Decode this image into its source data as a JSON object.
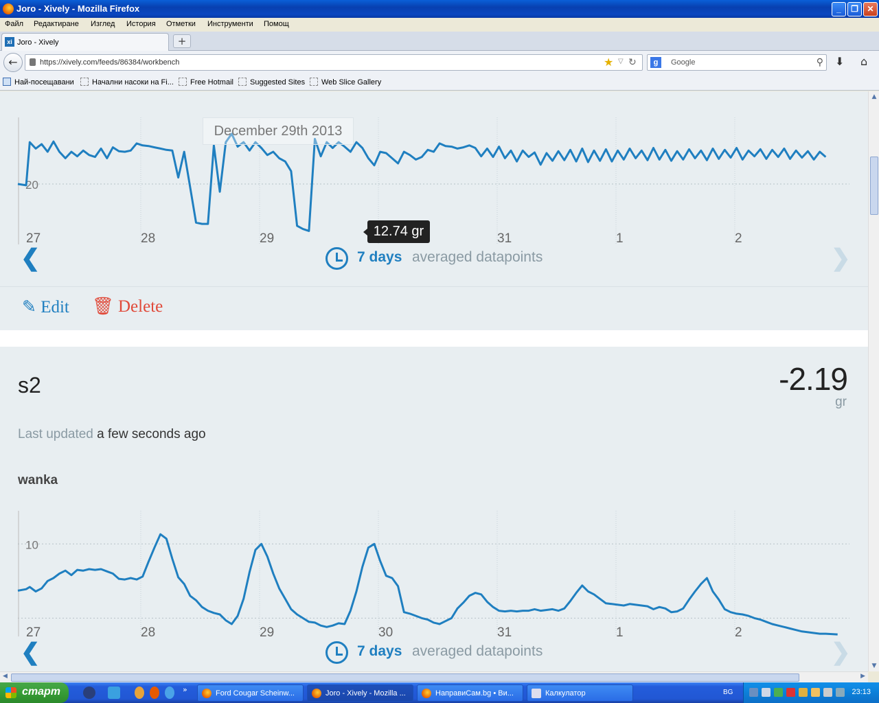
{
  "window": {
    "title": "Joro - Xively - Mozilla Firefox"
  },
  "menu": [
    "Файл",
    "Редактиране",
    "Изглед",
    "История",
    "Отметки",
    "Инструменти",
    "Помощ"
  ],
  "tab": {
    "label": "Joro - Xively"
  },
  "nav": {
    "url": "https://xively.com/feeds/86384/workbench",
    "search_placeholder": "Google"
  },
  "bookmarks": [
    "Най-посещавани",
    "Начални насоки на Fi...",
    "Free Hotmail",
    "Suggested Sites",
    "Web Slice Gallery"
  ],
  "chart1": {
    "tooltip_date": "December 29th 2013",
    "tooltip_value": "12.74 gr",
    "range_days": "7 days",
    "range_label": "averaged datapoints"
  },
  "actions": {
    "edit": "Edit",
    "delete": "Delete"
  },
  "datastream": {
    "id": "s2",
    "value": "-2.19",
    "unit": "gr",
    "updated_label": "Last updated",
    "updated_value": "a few seconds ago",
    "tag": "wanka"
  },
  "chart2": {
    "range_days": "7 days",
    "range_label": "averaged datapoints"
  },
  "chart_data": [
    {
      "type": "line",
      "title": "",
      "xlabel": "",
      "ylabel": "",
      "x_ticks": [
        "27",
        "28",
        "29",
        "30",
        "31",
        "1",
        "2"
      ],
      "y_ticks": [
        "20"
      ],
      "ylim": [
        12,
        28
      ],
      "grid": true,
      "x": [
        0,
        0.07,
        0.1,
        0.15,
        0.2,
        0.25,
        0.3,
        0.35,
        0.4,
        0.45,
        0.5,
        0.55,
        0.6,
        0.65,
        0.7,
        0.75,
        0.8,
        0.85,
        0.9,
        0.95,
        1.0,
        1.05,
        1.1,
        1.15,
        1.2,
        1.25,
        1.3,
        1.35,
        1.4,
        1.45,
        1.5,
        1.55,
        1.6,
        1.65,
        1.7,
        1.75,
        1.8,
        1.85,
        1.9,
        1.95,
        2.0,
        2.05,
        2.1,
        2.15,
        2.2,
        2.25,
        2.3,
        2.35,
        2.4,
        2.45,
        2.5,
        2.55,
        2.6,
        2.65,
        2.7,
        2.75,
        2.8,
        2.85,
        2.9,
        2.95,
        3.0,
        3.05,
        3.1,
        3.15,
        3.2,
        3.25,
        3.3,
        3.35,
        3.4,
        3.45,
        3.5,
        3.55,
        3.6,
        3.65,
        3.7,
        3.75,
        3.8,
        3.85,
        3.9,
        3.95,
        4.0,
        4.05,
        4.1,
        4.15,
        4.2,
        4.25,
        4.3,
        4.35,
        4.4,
        4.45,
        4.5,
        4.55,
        4.6,
        4.65,
        4.7,
        4.75,
        4.8,
        4.85,
        4.9,
        4.95,
        5.0,
        5.05,
        5.1,
        5.15,
        5.2,
        5.25,
        5.3,
        5.35,
        5.4,
        5.45,
        5.5,
        5.55,
        5.6,
        5.65,
        5.7,
        5.75,
        5.8,
        5.85,
        5.9,
        5.95,
        6.0,
        6.05,
        6.1,
        6.15,
        6.2,
        6.25,
        6.3,
        6.35,
        6.4,
        6.45,
        6.5,
        6.55,
        6.6,
        6.65,
        6.7,
        6.75,
        6.8,
        6.85,
        6.9,
        6.95,
        7.0
      ],
      "series": [
        {
          "values": [
            20,
            19.8,
            26.5,
            25.5,
            26.2,
            25.0,
            26.6,
            25.0,
            24.0,
            25.0,
            24.3,
            25.2,
            24.5,
            24.2,
            25.5,
            24.0,
            25.7,
            25.1,
            25.0,
            25.2,
            26.3,
            26.0,
            25.9,
            25.7,
            25.5,
            25.3,
            25.2,
            21.0,
            25.0,
            19.5,
            14.0,
            13.8,
            13.8,
            26.0,
            18.8,
            26.5,
            27.8,
            25.8,
            26.5,
            25.2,
            26.5,
            25.6,
            24.5,
            25.0,
            24.0,
            23.5,
            22.0,
            13.5,
            13.0,
            12.7,
            27.0,
            24.3,
            26.5,
            25.6,
            26.5,
            25.8,
            25.0,
            26.5,
            25.6,
            24.0,
            22.9,
            25.0,
            24.8,
            24.0,
            23.2,
            25.0,
            24.5,
            23.8,
            24.2,
            25.3,
            25.0,
            26.3,
            25.9,
            25.8,
            25.5,
            25.7,
            26.0,
            25.6,
            24.3,
            25.5,
            24.2,
            25.8,
            24.0,
            25.2,
            23.5,
            25.2,
            24.2,
            24.9,
            23.0,
            24.8,
            23.6,
            25.1,
            23.7,
            25.3,
            23.5,
            25.5,
            23.4,
            25.2,
            23.6,
            25.4,
            23.5,
            25.2,
            23.8,
            25.5,
            24.0,
            25.2,
            23.7,
            25.6,
            23.8,
            25.3,
            23.6,
            25.1,
            23.8,
            25.4,
            24.0,
            25.2,
            23.7,
            25.5,
            23.9,
            25.3,
            24.1,
            25.6,
            23.8,
            25.2,
            24.3,
            25.4,
            23.9,
            25.3,
            24.2,
            25.5,
            23.9,
            25.2,
            24.1,
            25.1,
            23.8,
            25.0,
            24.2
          ]
        }
      ]
    },
    {
      "type": "line",
      "title": "",
      "xlabel": "",
      "ylabel": "",
      "x_ticks": [
        "27",
        "28",
        "29",
        "30",
        "31",
        "1",
        "2"
      ],
      "y_ticks": [
        "10"
      ],
      "ylim": [
        -2,
        14
      ],
      "grid": true,
      "x": [
        0,
        0.07,
        0.1,
        0.15,
        0.2,
        0.25,
        0.3,
        0.35,
        0.4,
        0.45,
        0.5,
        0.55,
        0.6,
        0.65,
        0.7,
        0.75,
        0.8,
        0.85,
        0.9,
        0.95,
        1.0,
        1.05,
        1.1,
        1.15,
        1.2,
        1.25,
        1.3,
        1.35,
        1.4,
        1.45,
        1.5,
        1.55,
        1.6,
        1.65,
        1.7,
        1.75,
        1.8,
        1.85,
        1.9,
        1.95,
        2.0,
        2.05,
        2.1,
        2.15,
        2.2,
        2.25,
        2.3,
        2.35,
        2.4,
        2.45,
        2.5,
        2.55,
        2.6,
        2.65,
        2.7,
        2.75,
        2.8,
        2.85,
        2.9,
        2.95,
        3.0,
        3.05,
        3.1,
        3.15,
        3.2,
        3.25,
        3.3,
        3.35,
        3.4,
        3.45,
        3.5,
        3.55,
        3.6,
        3.65,
        3.7,
        3.75,
        3.8,
        3.85,
        3.9,
        3.95,
        4.0,
        4.05,
        4.1,
        4.15,
        4.2,
        4.25,
        4.3,
        4.35,
        4.4,
        4.45,
        4.5,
        4.55,
        4.6,
        4.65,
        4.7,
        4.75,
        4.8,
        4.85,
        4.9,
        4.95,
        5.0,
        5.05,
        5.1,
        5.15,
        5.2,
        5.25,
        5.3,
        5.35,
        5.4,
        5.45,
        5.5,
        5.55,
        5.6,
        5.65,
        5.7,
        5.75,
        5.8,
        5.85,
        5.9,
        5.95,
        6.0,
        6.05,
        6.1,
        6.15,
        6.2,
        6.25,
        6.3,
        6.35,
        6.4,
        6.45,
        6.5,
        6.55,
        6.6,
        6.65,
        6.7,
        6.75,
        6.8,
        6.85,
        6.9,
        6.95,
        7.0
      ],
      "series": [
        {
          "values": [
            3.7,
            3.9,
            4.2,
            3.6,
            4.0,
            5.0,
            5.4,
            6.0,
            6.4,
            5.8,
            6.5,
            6.4,
            6.6,
            6.5,
            6.6,
            6.3,
            6.0,
            5.3,
            5.2,
            5.4,
            5.2,
            5.6,
            7.6,
            9.5,
            11.3,
            10.7,
            8.0,
            5.5,
            4.6,
            3.0,
            2.4,
            1.5,
            1.0,
            0.7,
            0.5,
            -0.3,
            -0.8,
            0.3,
            2.6,
            6.2,
            9.2,
            10.0,
            8.3,
            6.0,
            4.0,
            2.6,
            1.2,
            0.5,
            0.0,
            -0.5,
            -0.6,
            -1.0,
            -1.2,
            -1.0,
            -0.7,
            -0.8,
            1.0,
            3.6,
            6.9,
            9.5,
            10.0,
            7.7,
            5.7,
            5.4,
            4.3,
            0.8,
            0.6,
            0.3,
            0.0,
            -0.2,
            -0.6,
            -0.8,
            -0.4,
            0.0,
            1.3,
            2.1,
            3.0,
            3.4,
            3.2,
            2.2,
            1.5,
            1.0,
            0.9,
            1.0,
            0.9,
            1.0,
            1.0,
            1.2,
            1.0,
            1.1,
            1.2,
            1.0,
            1.3,
            2.3,
            3.4,
            4.4,
            3.6,
            3.2,
            2.6,
            2.0,
            1.9,
            1.8,
            1.7,
            1.9,
            1.8,
            1.7,
            1.6,
            1.2,
            1.5,
            1.3,
            0.8,
            0.9,
            1.3,
            2.5,
            3.6,
            4.6,
            5.4,
            3.6,
            2.5,
            1.2,
            0.8,
            0.6,
            0.5,
            0.3,
            0.0,
            -0.2,
            -0.5,
            -0.8,
            -1.0,
            -1.2,
            -1.4,
            -1.6,
            -1.8,
            -1.9,
            -2.0,
            -2.1,
            -2.1,
            -2.15,
            -2.19
          ]
        }
      ]
    }
  ],
  "taskbar": {
    "start_label": "старт",
    "tasks": [
      "Ford Cougar Scheinw...",
      "Joro - Xively - Mozilla ...",
      "НаправиСам.bg • Ви...",
      "Калкулатор"
    ],
    "lang": "BG",
    "time": "23:13"
  }
}
